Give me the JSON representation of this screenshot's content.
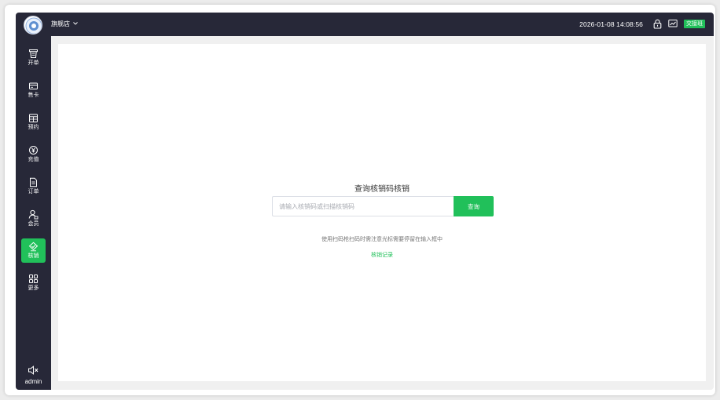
{
  "header": {
    "store_name": "旗舰店",
    "datetime": "2026-01-08 14:08:56",
    "handover_label": "交接班",
    "icons": [
      "logo",
      "chevron-down-icon",
      "lock-icon",
      "trend-icon"
    ]
  },
  "sidebar": {
    "items": [
      {
        "label": "开单",
        "icon": "order-bin-icon"
      },
      {
        "label": "售卡",
        "icon": "card-icon"
      },
      {
        "label": "预约",
        "icon": "calendar-icon"
      },
      {
        "label": "充值",
        "icon": "yen-icon"
      },
      {
        "label": "订单",
        "icon": "document-icon"
      },
      {
        "label": "会员",
        "icon": "member-icon"
      },
      {
        "label": "核销",
        "icon": "verify-icon",
        "active": true
      },
      {
        "label": "更多",
        "icon": "grid-icon"
      }
    ],
    "user": "admin"
  },
  "main": {
    "title": "查询核销码核销",
    "search": {
      "placeholder": "请输入核销码或扫描核销码",
      "value": "",
      "button_label": "查询"
    },
    "hint": "使用扫码枪扫码时需注意光标需要停留在输入框中",
    "link_label": "核销记录"
  },
  "colors": {
    "sidebar_bg": "#272838",
    "accent": "#21c05a"
  }
}
